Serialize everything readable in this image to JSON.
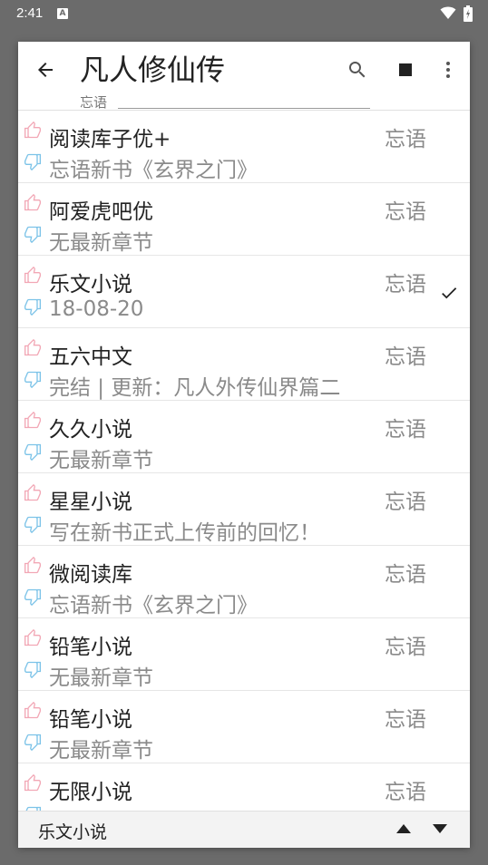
{
  "status_bar": {
    "time": "2:41",
    "app_icon": "A"
  },
  "toolbar": {
    "title": "凡人修仙传",
    "subtitle": "忘语",
    "icons": [
      "arrow-back-icon",
      "search-icon",
      "stop-icon",
      "more-vert-icon"
    ]
  },
  "sources": [
    {
      "name": "阅读库子优+",
      "origin": "忘语",
      "latest": "忘语新书《玄界之门》",
      "selected": false
    },
    {
      "name": "阿爱虎吧优",
      "origin": "忘语",
      "latest": "无最新章节",
      "selected": false
    },
    {
      "name": "乐文小说",
      "origin": "忘语",
      "latest": "18-08-20",
      "selected": true
    },
    {
      "name": "五六中文",
      "origin": "忘语",
      "latest": "完结 | 更新：凡人外传仙界篇二",
      "selected": false
    },
    {
      "name": "久久小说",
      "origin": "忘语",
      "latest": "无最新章节",
      "selected": false
    },
    {
      "name": "星星小说",
      "origin": "忘语",
      "latest": "写在新书正式上传前的回忆！",
      "selected": false
    },
    {
      "name": "微阅读库",
      "origin": "忘语",
      "latest": "忘语新书《玄界之门》",
      "selected": false
    },
    {
      "name": "铅笔小说",
      "origin": "忘语",
      "latest": "无最新章节",
      "selected": false
    },
    {
      "name": "铅笔小说",
      "origin": "忘语",
      "latest": "无最新章节",
      "selected": false
    },
    {
      "name": "无限小说",
      "origin": "忘语",
      "latest": "",
      "selected": false
    }
  ],
  "bottom_bar": {
    "current_source": "乐文小说"
  },
  "colors": {
    "thumb_up": "#f2a7b5",
    "thumb_down": "#7cc3e8",
    "overlay": "#6b6b6b"
  }
}
